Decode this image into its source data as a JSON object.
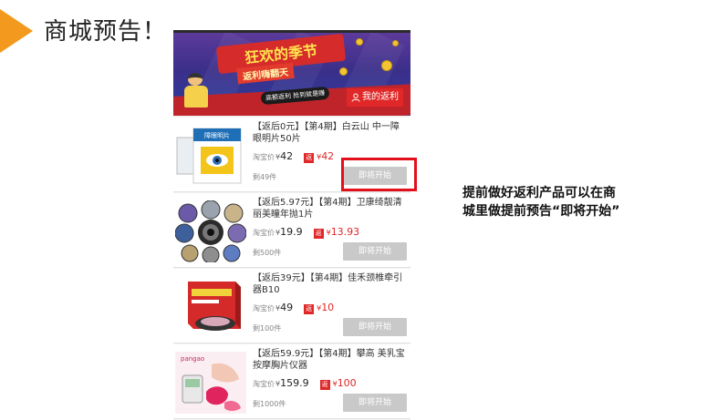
{
  "slide": {
    "title": "商城预告！",
    "note_line1": "提前做好返利产品可以在商",
    "note_line2": "城里做提前预告“即将开始”"
  },
  "banner": {
    "title": "狂欢的季节",
    "subtitle": "返利嗨翻天",
    "tag": "高额返利 抢到就是赚",
    "my_rebate_button": "我的返利"
  },
  "products": [
    {
      "title": "【返后0元】【第4期】白云山 中一障眼明片50片",
      "taobao_label": "淘宝价",
      "taobao_price": "42",
      "rebate_badge": "返",
      "rebate_price": "42",
      "stock": "剩49件",
      "button": "即将开始",
      "thumb_label": "障眼明片"
    },
    {
      "title": "【返后5.97元】【第4期】卫康绮靓清丽美瞳年抛1片",
      "taobao_label": "淘宝价",
      "taobao_price": "19.9",
      "rebate_badge": "返",
      "rebate_price": "13.93",
      "stock": "剩500件",
      "button": "即将开始"
    },
    {
      "title": "【返后39元】【第4期】佳禾颈椎牵引器B10",
      "taobao_label": "淘宝价",
      "taobao_price": "49",
      "rebate_badge": "返",
      "rebate_price": "10",
      "stock": "剩100件",
      "button": "即将开始"
    },
    {
      "title": "【返后59.9元】【第4期】攀高 美乳宝按摩胸片仪器",
      "taobao_label": "淘宝价",
      "taobao_price": "159.9",
      "rebate_badge": "返",
      "rebate_price": "100",
      "stock": "剩1000件",
      "button": "即将开始",
      "thumb_label": "pangao"
    }
  ],
  "currency_symbol": "¥",
  "colors": {
    "accent_red": "#e02828",
    "arrow_orange": "#f39a1e",
    "button_gray": "#c9c9c9",
    "highlight_red": "#e3101b"
  }
}
